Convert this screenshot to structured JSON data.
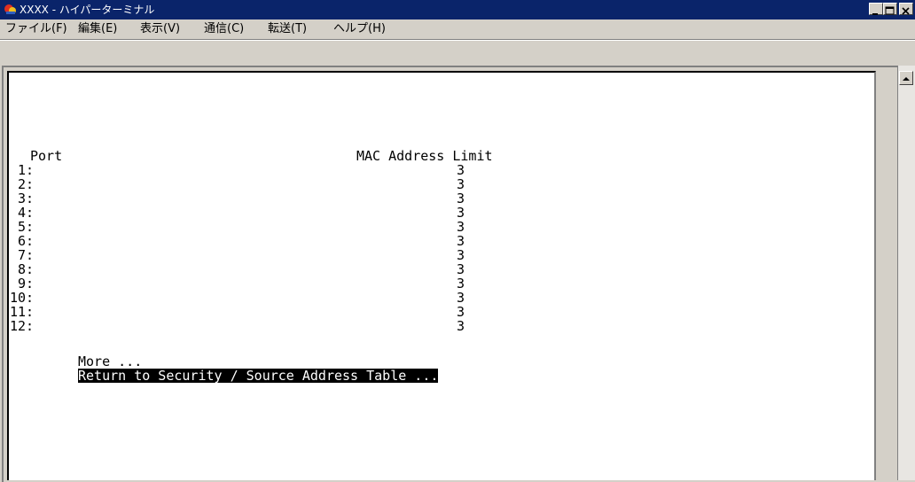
{
  "window": {
    "title": "XXXX - ハイパーターミナル",
    "minimize_glyph": "_",
    "maximize_glyph": "□",
    "close_glyph": "×"
  },
  "menu": {
    "items": [
      {
        "label": "ファイル(F)"
      },
      {
        "label": "編集(E)"
      },
      {
        "label": "表示(V)"
      },
      {
        "label": "通信(C)"
      },
      {
        "label": "転送(T)"
      },
      {
        "label": "ヘルプ(H)"
      }
    ]
  },
  "terminal": {
    "header_port": "Port",
    "header_limit": "MAC Address Limit",
    "rows": [
      {
        "port": "1:",
        "limit": "3"
      },
      {
        "port": "2:",
        "limit": "3"
      },
      {
        "port": "3:",
        "limit": "3"
      },
      {
        "port": "4:",
        "limit": "3"
      },
      {
        "port": "5:",
        "limit": "3"
      },
      {
        "port": "6:",
        "limit": "3"
      },
      {
        "port": "7:",
        "limit": "3"
      },
      {
        "port": "8:",
        "limit": "3"
      },
      {
        "port": "9:",
        "limit": "3"
      },
      {
        "port": "10:",
        "limit": "3"
      },
      {
        "port": "11:",
        "limit": "3"
      },
      {
        "port": "12:",
        "limit": "3"
      }
    ],
    "more": "More ...",
    "return": "Return to Security / Source Address Table ..."
  },
  "colors": {
    "titlebar": "#0a246a",
    "window_face": "#d4d0c8",
    "terminal_bg": "#ffffff",
    "terminal_text": "#000000",
    "selection_bg": "#000000",
    "selection_text": "#ffffff"
  },
  "icons": [
    "hyperterminal-app-icon",
    "minimize-icon",
    "maximize-icon",
    "close-icon",
    "scroll-up-arrow-icon"
  ]
}
